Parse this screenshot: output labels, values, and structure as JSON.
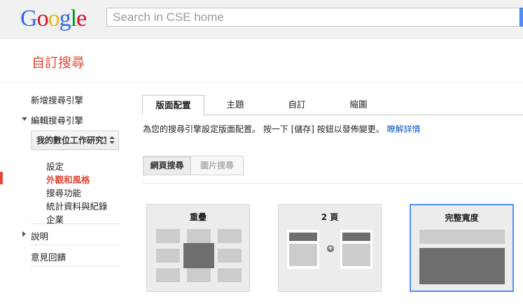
{
  "logo": {
    "letters": [
      {
        "char": "G",
        "color": "#3369e8"
      },
      {
        "char": "o",
        "color": "#d50f25"
      },
      {
        "char": "o",
        "color": "#eeb211"
      },
      {
        "char": "g",
        "color": "#3369e8"
      },
      {
        "char": "l",
        "color": "#009925"
      },
      {
        "char": "e",
        "color": "#d50f25"
      }
    ]
  },
  "search": {
    "placeholder": "Search in CSE home",
    "value": ""
  },
  "page_title": "自訂搜尋",
  "sidebar": {
    "new_engine": "新增搜尋引擎",
    "edit_engine": "編輯搜尋引擎",
    "engine_select": "我的數位工作研究室",
    "sub_items": [
      "設定",
      "外觀和風格",
      "搜尋功能",
      "統計資料與紀錄",
      "企業"
    ],
    "active_sub_index": 1,
    "help": "說明",
    "feedback": "意見回饋"
  },
  "tabs": [
    "版面配置",
    "主題",
    "自訂",
    "縮圖"
  ],
  "active_tab_index": 0,
  "description": {
    "text": "為您的搜尋引擎設定版面配置。 按一下 [儲存] 按鈕以發佈變更。",
    "link": "瞭解詳情"
  },
  "segmented": {
    "web": "網頁搜尋",
    "image": "圖片搜尋"
  },
  "layouts": [
    {
      "title": "重疊",
      "selected": false
    },
    {
      "title": "2 頁",
      "selected": false
    },
    {
      "title": "完整寬度",
      "selected": true
    }
  ],
  "colors": {
    "accent_red": "#dd4b39",
    "link_blue": "#1155cc",
    "select_blue": "#4d90fe"
  }
}
